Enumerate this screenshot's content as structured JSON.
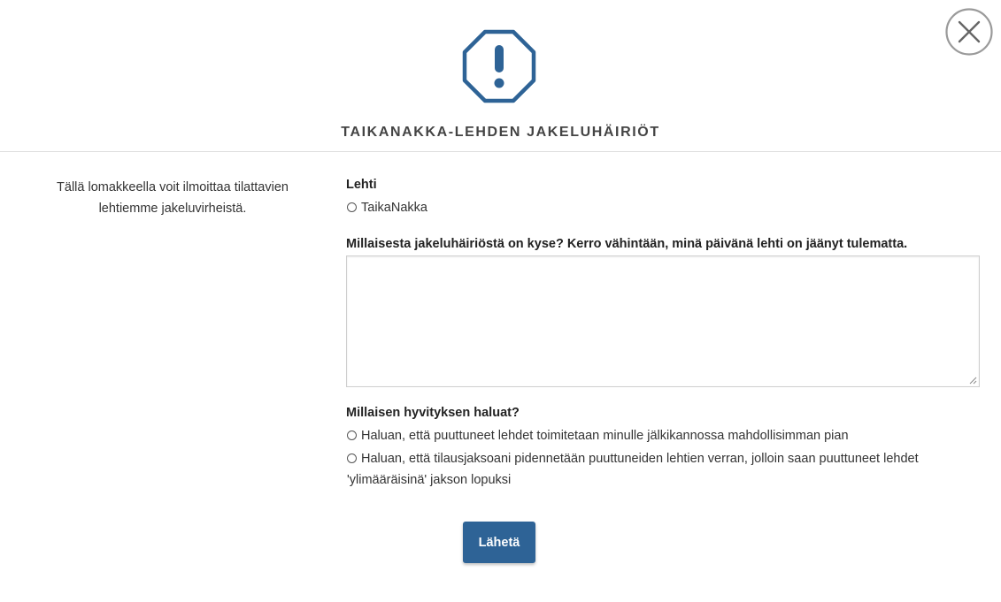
{
  "header": {
    "title": "TAIKANAKKA-LEHDEN JAKELUHÄIRIÖT",
    "warning_icon": "exclamation-octagon-icon",
    "close_icon": "close-circle-icon",
    "accent_color": "#2e6396"
  },
  "intro": {
    "text": "Tällä lomakkeella voit ilmoittaa tilattavien lehtiemme jakeluvirheistä."
  },
  "form": {
    "paper_label": "Lehti",
    "paper_options": [
      "TaikaNakka"
    ],
    "issue_label": "Millaisesta jakeluhäiriöstä on kyse? Kerro vähintään, minä päivänä lehti on jäänyt tulematta.",
    "issue_value": "",
    "compensation_label": "Millaisen hyvityksen haluat?",
    "compensation_options": [
      "Haluan, että puuttuneet lehdet toimitetaan minulle jälkikannossa mahdollisimman pian",
      "Haluan, että tilausjaksoani pidennetään puuttuneiden lehtien verran, jolloin saan puuttuneet lehdet 'ylimääräisinä' jakson lopuksi"
    ],
    "submit_label": "Lähetä"
  }
}
